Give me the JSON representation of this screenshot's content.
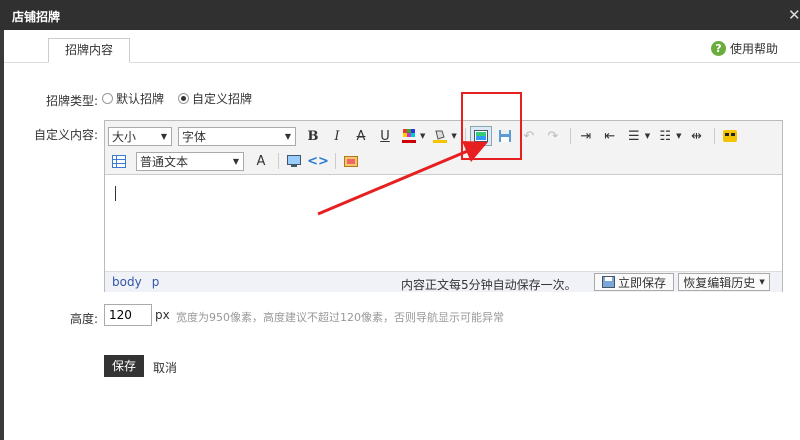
{
  "window": {
    "title": "店铺招牌",
    "close_glyph": "✕"
  },
  "tabs": [
    {
      "label": "招牌内容"
    }
  ],
  "help": {
    "label": "使用帮助",
    "icon": "question-icon",
    "glyph": "?"
  },
  "sign_type": {
    "label": "招牌类型:",
    "options": [
      {
        "label": "默认招牌",
        "checked": false
      },
      {
        "label": "自定义招牌",
        "checked": true
      }
    ]
  },
  "custom_content": {
    "label": "自定义内容:"
  },
  "toolbar": {
    "size_select": "大小",
    "font_select": "字体",
    "paragraph_select": "普通文本",
    "bold": "B",
    "italic": "I",
    "strike": "A",
    "underline": "U"
  },
  "statusbar": {
    "path": [
      "body",
      "p"
    ],
    "autosave": "内容正文每5分钟自动保存一次。",
    "save_now": "立即保存",
    "restore_history": "恢复编辑历史"
  },
  "height": {
    "label": "高度:",
    "value": "120",
    "unit": "px",
    "hint": "宽度为950像素，高度建议不超过120像素，否则导航显示可能异常"
  },
  "actions": {
    "save": "保存",
    "cancel": "取消"
  },
  "colors": {
    "highlight": "#e62020",
    "title_bar": "#303030",
    "help_icon": "#6aad3d"
  }
}
